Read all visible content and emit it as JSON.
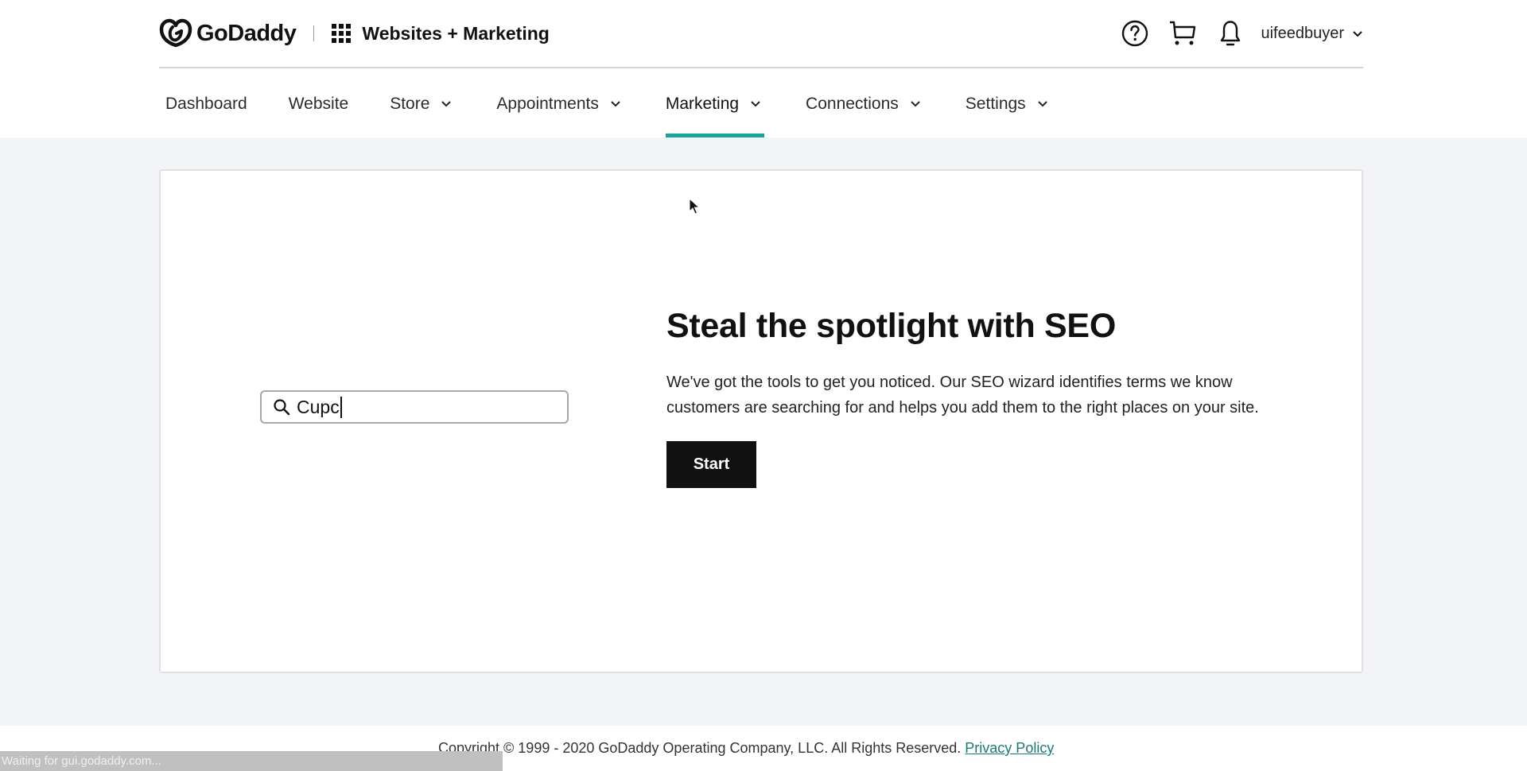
{
  "header": {
    "brand": "GoDaddy",
    "app_title": "Websites + Marketing",
    "icons": [
      "help-icon",
      "cart-icon",
      "bell-icon"
    ],
    "username": "uifeedbuyer"
  },
  "nav": {
    "items": [
      {
        "label": "Dashboard",
        "has_dropdown": false,
        "active": false
      },
      {
        "label": "Website",
        "has_dropdown": false,
        "active": false
      },
      {
        "label": "Store",
        "has_dropdown": true,
        "active": false
      },
      {
        "label": "Appointments",
        "has_dropdown": true,
        "active": false
      },
      {
        "label": "Marketing",
        "has_dropdown": true,
        "active": true
      },
      {
        "label": "Connections",
        "has_dropdown": true,
        "active": false
      },
      {
        "label": "Settings",
        "has_dropdown": true,
        "active": false
      }
    ],
    "active_color": "#1ba39b"
  },
  "promo": {
    "search_value": "Cupc",
    "headline": "Steal the spotlight with SEO",
    "description": "We've got the tools to get you noticed. Our SEO wizard identifies terms we know customers are searching for and helps you add them to the right places on your site.",
    "start_label": "Start"
  },
  "footer": {
    "copyright": "Copyright © 1999 - 2020 GoDaddy Operating Company, LLC. All Rights Reserved.",
    "privacy_label": "Privacy Policy"
  },
  "status_bar": {
    "text": "Waiting for gui.godaddy.com..."
  }
}
